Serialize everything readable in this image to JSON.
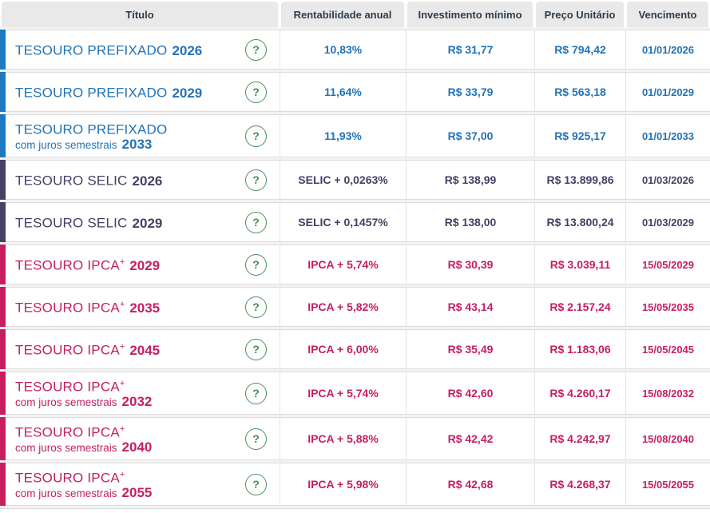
{
  "table": {
    "headers": [
      "Título",
      "Rentabilidade anual",
      "Investimento mínimo",
      "Preço Unitário",
      "Vencimento"
    ],
    "rows": [
      {
        "category": "prefixado",
        "name": "TESOURO PREFIXADO",
        "sup": "",
        "sub": "",
        "year": "2026",
        "rate": "10,83%",
        "min": "R$ 31,77",
        "price": "R$ 794,42",
        "maturity": "01/01/2026"
      },
      {
        "category": "prefixado",
        "name": "TESOURO PREFIXADO",
        "sup": "",
        "sub": "",
        "year": "2029",
        "rate": "11,64%",
        "min": "R$ 33,79",
        "price": "R$ 563,18",
        "maturity": "01/01/2029"
      },
      {
        "category": "prefixado",
        "name": "TESOURO PREFIXADO",
        "sup": "",
        "sub": "com juros semestrais",
        "year": "2033",
        "rate": "11,93%",
        "min": "R$ 37,00",
        "price": "R$ 925,17",
        "maturity": "01/01/2033"
      },
      {
        "category": "selic",
        "name": "TESOURO SELIC",
        "sup": "",
        "sub": "",
        "year": "2026",
        "rate": "SELIC + 0,0263%",
        "min": "R$ 138,99",
        "price": "R$ 13.899,86",
        "maturity": "01/03/2026"
      },
      {
        "category": "selic",
        "name": "TESOURO SELIC",
        "sup": "",
        "sub": "",
        "year": "2029",
        "rate": "SELIC + 0,1457%",
        "min": "R$ 138,00",
        "price": "R$ 13.800,24",
        "maturity": "01/03/2029"
      },
      {
        "category": "ipca",
        "name": "TESOURO IPCA",
        "sup": "+",
        "sub": "",
        "year": "2029",
        "rate": "IPCA + 5,74%",
        "min": "R$ 30,39",
        "price": "R$ 3.039,11",
        "maturity": "15/05/2029"
      },
      {
        "category": "ipca",
        "name": "TESOURO IPCA",
        "sup": "+",
        "sub": "",
        "year": "2035",
        "rate": "IPCA + 5,82%",
        "min": "R$ 43,14",
        "price": "R$ 2.157,24",
        "maturity": "15/05/2035"
      },
      {
        "category": "ipca",
        "name": "TESOURO IPCA",
        "sup": "+",
        "sub": "",
        "year": "2045",
        "rate": "IPCA + 6,00%",
        "min": "R$ 35,49",
        "price": "R$ 1.183,06",
        "maturity": "15/05/2045"
      },
      {
        "category": "ipca",
        "name": "TESOURO IPCA",
        "sup": "+",
        "sub": "com juros semestrais",
        "year": "2032",
        "rate": "IPCA + 5,74%",
        "min": "R$ 42,60",
        "price": "R$ 4.260,17",
        "maturity": "15/08/2032"
      },
      {
        "category": "ipca",
        "name": "TESOURO IPCA",
        "sup": "+",
        "sub": "com juros semestrais",
        "year": "2040",
        "rate": "IPCA + 5,88%",
        "min": "R$ 42,42",
        "price": "R$ 4.242,97",
        "maturity": "15/08/2040"
      },
      {
        "category": "ipca",
        "name": "TESOURO IPCA",
        "sup": "+",
        "sub": "com juros semestrais",
        "year": "2055",
        "rate": "IPCA + 5,98%",
        "min": "R$ 42,68",
        "price": "R$ 4.268,37",
        "maturity": "15/05/2055"
      }
    ]
  },
  "help_icon_glyph": "?",
  "colors": {
    "prefixado_text": "#2273b6",
    "prefixado_bar": "#1b7ac2",
    "selic_text": "#454064",
    "selic_bar": "#454064",
    "ipca_text": "#c41f63",
    "ipca_bar": "#c81e5e",
    "header_text": "#2d3d4e",
    "header_bg": "#e9e9e9",
    "help_green": "#44904f"
  }
}
